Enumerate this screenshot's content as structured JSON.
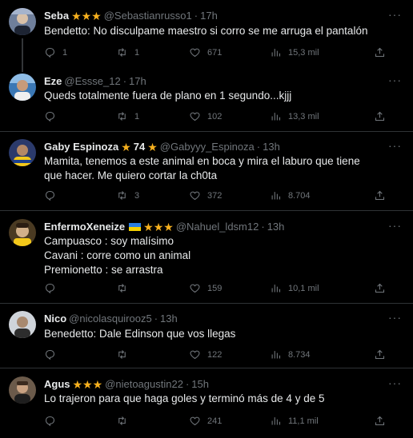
{
  "tweets": [
    {
      "name": "Seba",
      "stars": "★★★",
      "handle": "@Sebastianrusso1",
      "dot": "·",
      "time": "17h",
      "body": "Bendetto: No disculpame maestro si corro se me arruga el pantalón",
      "replies": "1",
      "retweets": "1",
      "likes": "671",
      "views": "15,3 mil"
    },
    {
      "name": "Eze",
      "handle": "@Essse_12",
      "dot": "·",
      "time": "17h",
      "body": "Queds totalmente fuera de plano en 1 segundo...kjjj",
      "replies": "",
      "retweets": "1",
      "likes": "102",
      "views": "13,3 mil"
    },
    {
      "name": "Gaby Espinoza",
      "star_left": "★",
      "number": "74",
      "star_right": "★",
      "handle": "@Gabyyy_Espinoza",
      "dot": "·",
      "time": "13h",
      "body": "Mamita, tenemos a este animal en boca y mira el laburo que tiene que hacer. Me quiero cortar la ch0ta",
      "replies": "",
      "retweets": "3",
      "likes": "372",
      "views": "8.704"
    },
    {
      "name": "EnfermoXeneize",
      "stars": "★★★",
      "handle": "@Nahuel_ldsm12",
      "dot": "·",
      "time": "13h",
      "body_lines": [
        "Campuasco : soy malísimo",
        "Cavani : corre como un animal",
        "Premionetto : se arrastra"
      ],
      "replies": "",
      "retweets": "",
      "likes": "159",
      "views": "10,1 mil"
    },
    {
      "name": "Nico",
      "handle": "@nicolasquirooz5",
      "dot": "·",
      "time": "13h",
      "body": "Benedetto: Dale Edinson que vos llegas",
      "replies": "",
      "retweets": "",
      "likes": "122",
      "views": "8.734"
    },
    {
      "name": "Agus",
      "stars": "★★★",
      "handle": "@nietoagustin22",
      "dot": "·",
      "time": "15h",
      "body": "Lo trajeron para que haga goles y terminó más de 4 y de 5",
      "replies": "",
      "retweets": "",
      "likes": "241",
      "views": "11,1 mil"
    }
  ],
  "more_glyph": "···",
  "icons": [
    "reply-icon",
    "retweet-icon",
    "like-icon",
    "views-icon",
    "share-icon"
  ]
}
